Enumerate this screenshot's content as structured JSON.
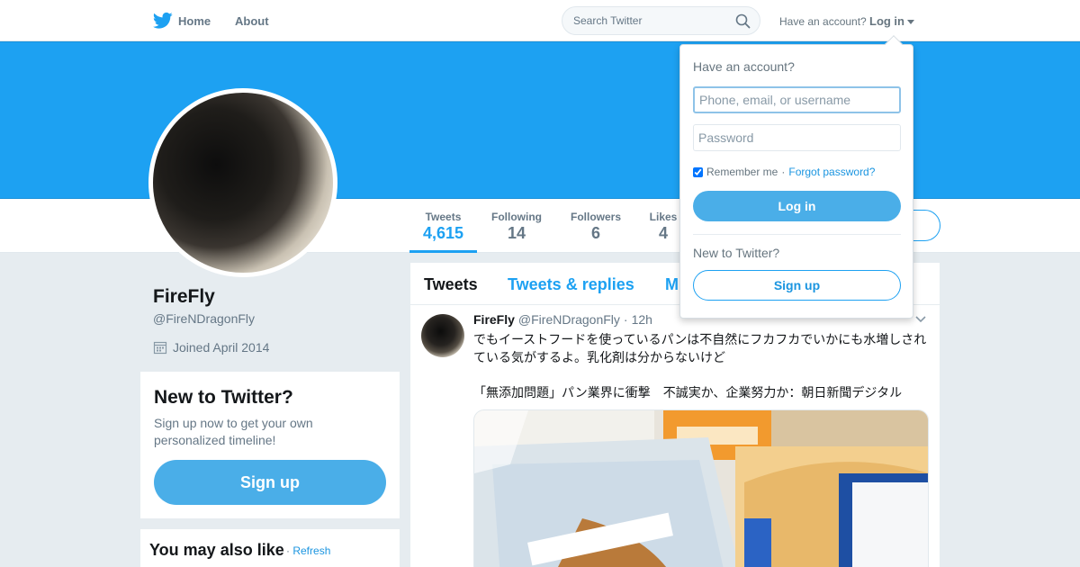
{
  "nav": {
    "home_label": "Home",
    "about_label": "About",
    "search_placeholder": "Search Twitter",
    "have_account": "Have an account?",
    "login_label": "Log in"
  },
  "profile": {
    "name": "FireFly",
    "handle": "@FireNDragonFly",
    "joined": "Joined April 2014"
  },
  "stats": [
    {
      "label": "Tweets",
      "value": "4,615"
    },
    {
      "label": "Following",
      "value": "14"
    },
    {
      "label": "Followers",
      "value": "6"
    },
    {
      "label": "Likes",
      "value": "4"
    }
  ],
  "signup_card": {
    "title": "New to Twitter?",
    "text": "Sign up now to get your own personalized timeline!",
    "button": "Sign up"
  },
  "also_like": {
    "title": "You may also like",
    "separator": "·",
    "refresh": "Refresh"
  },
  "timeline": {
    "tabs": [
      "Tweets",
      "Tweets & replies",
      "M"
    ]
  },
  "tweet": {
    "name": "FireFly",
    "handle": "@FireNDragonFly",
    "dot": "·",
    "time": "12h",
    "text": "でもイーストフードを使っているパンは不自然にフカフカでいかにも水増しされている気がするよ。乳化剤は分からないけど",
    "link_text": "「無添加問題」パン業界に衝撃　不誠実か、企業努力か：朝日新聞デジタル"
  },
  "login_dropdown": {
    "title": "Have an account?",
    "username_placeholder": "Phone, email, or username",
    "password_placeholder": "Password",
    "remember_label": "Remember me",
    "separator": "·",
    "forgot_label": "Forgot password?",
    "login_button": "Log in",
    "new_label": "New to Twitter?",
    "signup_button": "Sign up"
  },
  "colors": {
    "brand": "#1da1f2",
    "link": "#1b95e0",
    "button_fill": "#4aaee8",
    "background": "#e6ecf0"
  }
}
